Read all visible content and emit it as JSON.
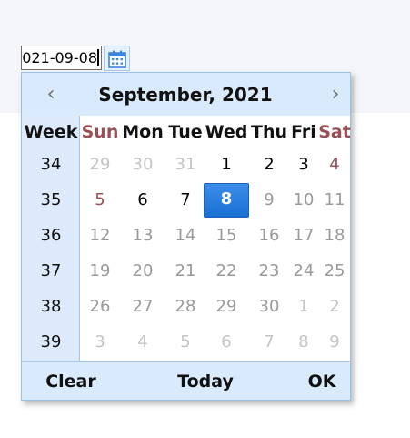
{
  "date_input": {
    "value": "021-09-08"
  },
  "calendar_button": {
    "icon": "calendar-icon"
  },
  "calendar": {
    "prev_label": "‹",
    "next_label": "›",
    "month_title": "September, 2021",
    "week_header": "Week",
    "weekdays": [
      "Sun",
      "Mon",
      "Tue",
      "Wed",
      "Thu",
      "Fri",
      "Sat"
    ],
    "rows": [
      {
        "week": "34",
        "days": [
          {
            "label": "29",
            "state": "other"
          },
          {
            "label": "30",
            "state": "other"
          },
          {
            "label": "31",
            "state": "other"
          },
          {
            "label": "1",
            "state": "current"
          },
          {
            "label": "2",
            "state": "current"
          },
          {
            "label": "3",
            "state": "current"
          },
          {
            "label": "4",
            "state": "weekend"
          }
        ]
      },
      {
        "week": "35",
        "days": [
          {
            "label": "5",
            "state": "weekend"
          },
          {
            "label": "6",
            "state": "current"
          },
          {
            "label": "7",
            "state": "current"
          },
          {
            "label": "8",
            "state": "selected"
          },
          {
            "label": "9",
            "state": "gray"
          },
          {
            "label": "10",
            "state": "gray"
          },
          {
            "label": "11",
            "state": "gray"
          }
        ]
      },
      {
        "week": "36",
        "days": [
          {
            "label": "12",
            "state": "gray"
          },
          {
            "label": "13",
            "state": "gray"
          },
          {
            "label": "14",
            "state": "gray"
          },
          {
            "label": "15",
            "state": "gray"
          },
          {
            "label": "16",
            "state": "gray"
          },
          {
            "label": "17",
            "state": "gray"
          },
          {
            "label": "18",
            "state": "gray"
          }
        ]
      },
      {
        "week": "37",
        "days": [
          {
            "label": "19",
            "state": "gray"
          },
          {
            "label": "20",
            "state": "gray"
          },
          {
            "label": "21",
            "state": "gray"
          },
          {
            "label": "22",
            "state": "gray"
          },
          {
            "label": "23",
            "state": "gray"
          },
          {
            "label": "24",
            "state": "gray"
          },
          {
            "label": "25",
            "state": "gray"
          }
        ]
      },
      {
        "week": "38",
        "days": [
          {
            "label": "26",
            "state": "gray"
          },
          {
            "label": "27",
            "state": "gray"
          },
          {
            "label": "28",
            "state": "gray"
          },
          {
            "label": "29",
            "state": "gray"
          },
          {
            "label": "30",
            "state": "gray"
          },
          {
            "label": "1",
            "state": "other"
          },
          {
            "label": "2",
            "state": "other"
          }
        ]
      },
      {
        "week": "39",
        "days": [
          {
            "label": "3",
            "state": "other"
          },
          {
            "label": "4",
            "state": "other"
          },
          {
            "label": "5",
            "state": "other"
          },
          {
            "label": "6",
            "state": "other"
          },
          {
            "label": "7",
            "state": "other"
          },
          {
            "label": "8",
            "state": "other"
          },
          {
            "label": "9",
            "state": "other"
          }
        ]
      }
    ],
    "footer": {
      "clear_label": "Clear",
      "today_label": "Today",
      "ok_label": "OK"
    }
  },
  "colors": {
    "selected_bg": "#1a6fd4",
    "header_bg": "#d9eafc",
    "weekend_text": "#9a4f55",
    "muted_text": "#9a9a9a"
  }
}
